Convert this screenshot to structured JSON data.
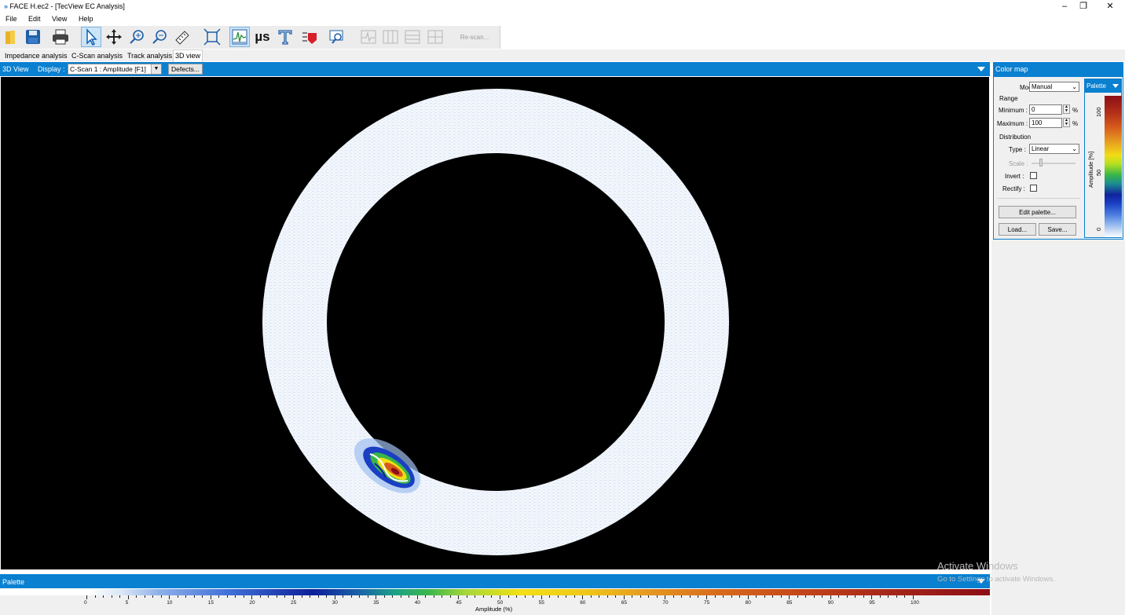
{
  "window": {
    "title": "FACE H.ec2 - [TecView EC Analysis]",
    "minimize": "–",
    "restore": "❐",
    "close": "✕"
  },
  "menu": [
    "File",
    "Edit",
    "View",
    "Help"
  ],
  "toolbar": {
    "rescan_label": "Re-scan...",
    "us_label": "µs"
  },
  "tabs": [
    {
      "label": "Impedance analysis"
    },
    {
      "label": "C-Scan analysis"
    },
    {
      "label": "Track analysis"
    },
    {
      "label": "3D view",
      "active": true
    }
  ],
  "view": {
    "title": "3D View",
    "display_label": "Display :",
    "display_value": "C-Scan 1 : Amplitude [F1]",
    "defects_label": "Defects..."
  },
  "colormap": {
    "title": "Color map",
    "mode_label": "Mode :",
    "mode_value": "Manual",
    "range_label": "Range",
    "minimum_label": "Minimum :",
    "minimum_value": "0",
    "maximum_label": "Maximum :",
    "maximum_value": "100",
    "percent": "%",
    "distribution_label": "Distribution",
    "type_label": "Type :",
    "type_value": "Linear",
    "scale_label": "Scale :",
    "invert_label": "Invert :",
    "rectify_label": "Rectify :",
    "edit_palette_label": "Edit palette...",
    "load_label": "Load...",
    "save_label": "Save...",
    "palette_tab": "Palette",
    "palette_axis_label": "Amplitude [%]",
    "palette_top": "100",
    "palette_mid": "50",
    "palette_bottom": "0"
  },
  "bottom_palette": {
    "title": "Palette",
    "axis_label": "Amplitude (%)",
    "ticks": [
      "0",
      "5",
      "10",
      "15",
      "20",
      "25",
      "30",
      "35",
      "40",
      "45",
      "50",
      "55",
      "60",
      "65",
      "70",
      "75",
      "80",
      "85",
      "90",
      "95",
      "100"
    ]
  },
  "watermark": {
    "line1": "Activate Windows",
    "line2": "Go to Settings to activate Windows."
  },
  "colors": {
    "accent": "#0a80d0",
    "canvas_bg": "#000000"
  }
}
